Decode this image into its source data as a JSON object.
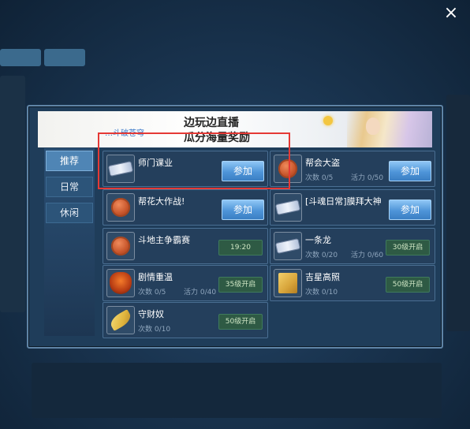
{
  "close_label": "×",
  "banner": {
    "logo_text": "…斗破苍穹",
    "line1": "边玩边直播",
    "line2": "瓜分海量奖励"
  },
  "sidebar": {
    "tabs": [
      {
        "label": "推荐",
        "active": true
      },
      {
        "label": "日常",
        "active": false
      },
      {
        "label": "休闲",
        "active": false
      }
    ]
  },
  "activities": [
    {
      "name": "师门课业",
      "icon": "ticket-icon",
      "button": "参加"
    },
    {
      "name": "帮会大盗",
      "icon": "coin-icon",
      "count": "次数 0/5",
      "vigor": "活力 0/50",
      "button": "参加"
    },
    {
      "name": "帮花大作战!",
      "icon": "coin-icon",
      "button": "参加"
    },
    {
      "name": "[斗魂日常]膜拜大神",
      "icon": "ticket-icon",
      "button": "参加"
    },
    {
      "name": "斗地主争霸赛",
      "icon": "coin-icon",
      "tag": "19:20"
    },
    {
      "name": "一条龙",
      "icon": "ticket-icon",
      "count": "次数 0/20",
      "vigor": "活力 0/60",
      "tag": "30级开启"
    },
    {
      "name": "剧情重温",
      "icon": "mask-icon",
      "count": "次数 0/5",
      "vigor": "活力 0/40",
      "tag": "35级开启"
    },
    {
      "name": "吉星高照",
      "icon": "scroll-icon",
      "count": "次数 0/10",
      "tag": "50级开启"
    },
    {
      "name": "守财奴",
      "icon": "leaf-icon",
      "count": "次数 0/10",
      "tag": "50级开启"
    }
  ]
}
